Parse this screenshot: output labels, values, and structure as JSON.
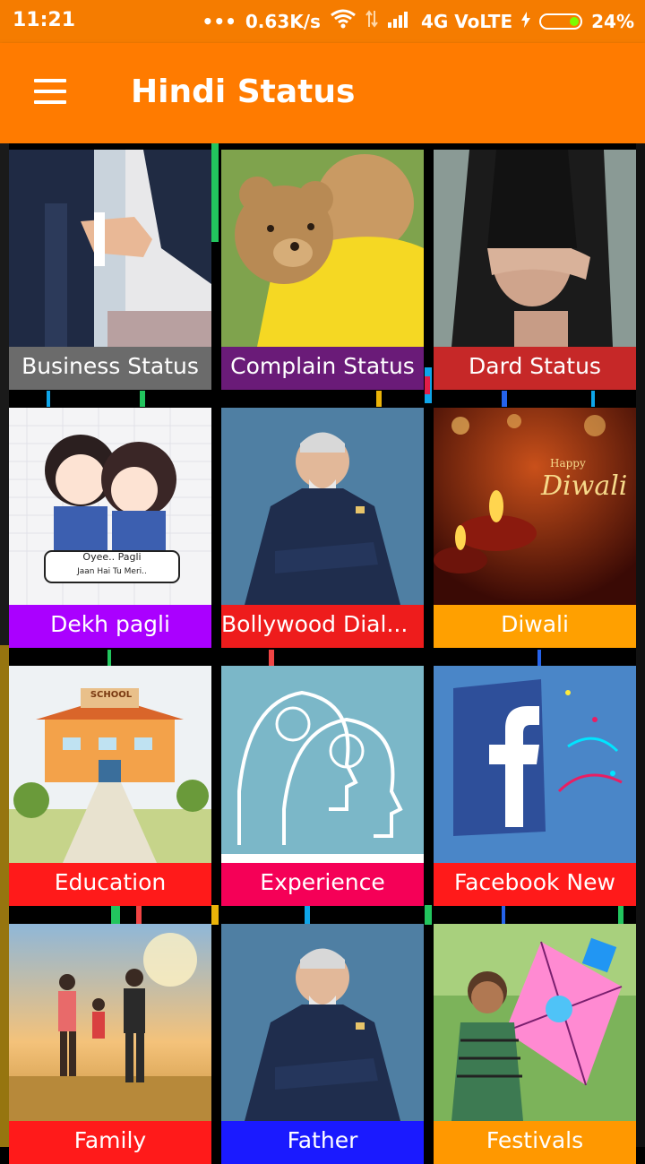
{
  "status_bar": {
    "time": "11:21",
    "network_speed": "0.63K/s",
    "network_type": "4G VoLTE",
    "battery": "24%"
  },
  "toolbar": {
    "title": "Hindi Status"
  },
  "tiles": [
    {
      "label": "Business Status",
      "label_color": "#6b6b6b",
      "image": "handshake"
    },
    {
      "label": "Complain Status",
      "label_color": "#6a1b78",
      "image": "teddy-bear-boy"
    },
    {
      "label": "Dard Status",
      "label_color": "#c62828",
      "image": "sad-girl"
    },
    {
      "label": "Dekh pagli",
      "label_color": "#aa00ff",
      "image": "cartoon-couple",
      "caption_lines": [
        "Oyee.. Pagli",
        "Jaan Hai Tu Meri.."
      ]
    },
    {
      "label": "Bollywood Dial...",
      "label_color": "#ee1c1c",
      "image": "man-in-suit"
    },
    {
      "label": "Diwali",
      "label_color": "#ffa000",
      "image": "diwali-lamps",
      "caption_lines": [
        "Happy",
        "Diwali"
      ]
    },
    {
      "label": "Education",
      "label_color": "#ff1a1a",
      "image": "school",
      "caption_lines": [
        "SCHOOL"
      ]
    },
    {
      "label": "Experience",
      "label_color": "#f50057",
      "image": "heads-bulbs"
    },
    {
      "label": "Facebook New",
      "label_color": "#ff1a1a",
      "image": "facebook-logo"
    },
    {
      "label": "Family",
      "label_color": "#ff1a1a",
      "image": "family-sunset"
    },
    {
      "label": "Father",
      "label_color": "#1a1aff",
      "image": "man-in-suit"
    },
    {
      "label": "Festivals",
      "label_color": "#ff9800",
      "image": "boy-with-kite"
    }
  ]
}
